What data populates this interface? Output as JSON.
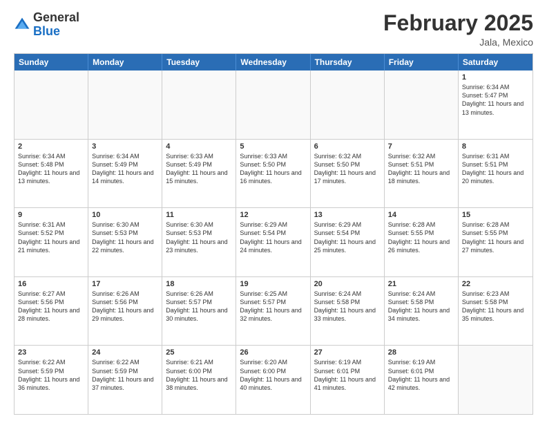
{
  "header": {
    "logo_general": "General",
    "logo_blue": "Blue",
    "month_title": "February 2025",
    "location": "Jala, Mexico"
  },
  "weekdays": [
    "Sunday",
    "Monday",
    "Tuesday",
    "Wednesday",
    "Thursday",
    "Friday",
    "Saturday"
  ],
  "rows": [
    [
      {
        "day": "",
        "text": ""
      },
      {
        "day": "",
        "text": ""
      },
      {
        "day": "",
        "text": ""
      },
      {
        "day": "",
        "text": ""
      },
      {
        "day": "",
        "text": ""
      },
      {
        "day": "",
        "text": ""
      },
      {
        "day": "1",
        "text": "Sunrise: 6:34 AM\nSunset: 5:47 PM\nDaylight: 11 hours and 13 minutes."
      }
    ],
    [
      {
        "day": "2",
        "text": "Sunrise: 6:34 AM\nSunset: 5:48 PM\nDaylight: 11 hours and 13 minutes."
      },
      {
        "day": "3",
        "text": "Sunrise: 6:34 AM\nSunset: 5:49 PM\nDaylight: 11 hours and 14 minutes."
      },
      {
        "day": "4",
        "text": "Sunrise: 6:33 AM\nSunset: 5:49 PM\nDaylight: 11 hours and 15 minutes."
      },
      {
        "day": "5",
        "text": "Sunrise: 6:33 AM\nSunset: 5:50 PM\nDaylight: 11 hours and 16 minutes."
      },
      {
        "day": "6",
        "text": "Sunrise: 6:32 AM\nSunset: 5:50 PM\nDaylight: 11 hours and 17 minutes."
      },
      {
        "day": "7",
        "text": "Sunrise: 6:32 AM\nSunset: 5:51 PM\nDaylight: 11 hours and 18 minutes."
      },
      {
        "day": "8",
        "text": "Sunrise: 6:31 AM\nSunset: 5:51 PM\nDaylight: 11 hours and 20 minutes."
      }
    ],
    [
      {
        "day": "9",
        "text": "Sunrise: 6:31 AM\nSunset: 5:52 PM\nDaylight: 11 hours and 21 minutes."
      },
      {
        "day": "10",
        "text": "Sunrise: 6:30 AM\nSunset: 5:53 PM\nDaylight: 11 hours and 22 minutes."
      },
      {
        "day": "11",
        "text": "Sunrise: 6:30 AM\nSunset: 5:53 PM\nDaylight: 11 hours and 23 minutes."
      },
      {
        "day": "12",
        "text": "Sunrise: 6:29 AM\nSunset: 5:54 PM\nDaylight: 11 hours and 24 minutes."
      },
      {
        "day": "13",
        "text": "Sunrise: 6:29 AM\nSunset: 5:54 PM\nDaylight: 11 hours and 25 minutes."
      },
      {
        "day": "14",
        "text": "Sunrise: 6:28 AM\nSunset: 5:55 PM\nDaylight: 11 hours and 26 minutes."
      },
      {
        "day": "15",
        "text": "Sunrise: 6:28 AM\nSunset: 5:55 PM\nDaylight: 11 hours and 27 minutes."
      }
    ],
    [
      {
        "day": "16",
        "text": "Sunrise: 6:27 AM\nSunset: 5:56 PM\nDaylight: 11 hours and 28 minutes."
      },
      {
        "day": "17",
        "text": "Sunrise: 6:26 AM\nSunset: 5:56 PM\nDaylight: 11 hours and 29 minutes."
      },
      {
        "day": "18",
        "text": "Sunrise: 6:26 AM\nSunset: 5:57 PM\nDaylight: 11 hours and 30 minutes."
      },
      {
        "day": "19",
        "text": "Sunrise: 6:25 AM\nSunset: 5:57 PM\nDaylight: 11 hours and 32 minutes."
      },
      {
        "day": "20",
        "text": "Sunrise: 6:24 AM\nSunset: 5:58 PM\nDaylight: 11 hours and 33 minutes."
      },
      {
        "day": "21",
        "text": "Sunrise: 6:24 AM\nSunset: 5:58 PM\nDaylight: 11 hours and 34 minutes."
      },
      {
        "day": "22",
        "text": "Sunrise: 6:23 AM\nSunset: 5:58 PM\nDaylight: 11 hours and 35 minutes."
      }
    ],
    [
      {
        "day": "23",
        "text": "Sunrise: 6:22 AM\nSunset: 5:59 PM\nDaylight: 11 hours and 36 minutes."
      },
      {
        "day": "24",
        "text": "Sunrise: 6:22 AM\nSunset: 5:59 PM\nDaylight: 11 hours and 37 minutes."
      },
      {
        "day": "25",
        "text": "Sunrise: 6:21 AM\nSunset: 6:00 PM\nDaylight: 11 hours and 38 minutes."
      },
      {
        "day": "26",
        "text": "Sunrise: 6:20 AM\nSunset: 6:00 PM\nDaylight: 11 hours and 40 minutes."
      },
      {
        "day": "27",
        "text": "Sunrise: 6:19 AM\nSunset: 6:01 PM\nDaylight: 11 hours and 41 minutes."
      },
      {
        "day": "28",
        "text": "Sunrise: 6:19 AM\nSunset: 6:01 PM\nDaylight: 11 hours and 42 minutes."
      },
      {
        "day": "",
        "text": ""
      }
    ]
  ]
}
